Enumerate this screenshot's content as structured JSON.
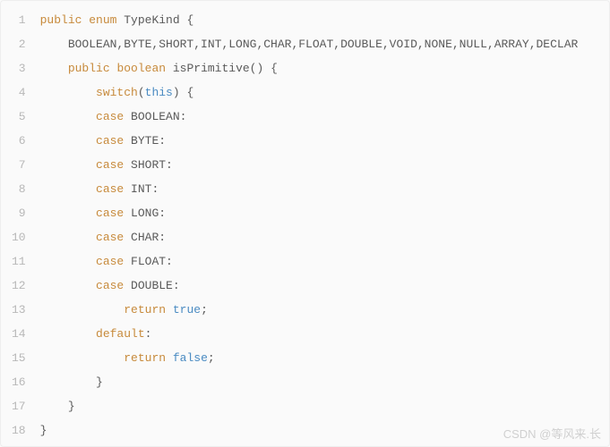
{
  "lines": [
    {
      "n": "1",
      "t": [
        {
          "c": "kw",
          "v": "public"
        },
        {
          "c": "txt",
          "v": " "
        },
        {
          "c": "kw",
          "v": "enum"
        },
        {
          "c": "txt",
          "v": " TypeKind {"
        }
      ]
    },
    {
      "n": "2",
      "t": [
        {
          "c": "txt",
          "v": "    BOOLEAN,BYTE,SHORT,INT,LONG,CHAR,FLOAT,DOUBLE,VOID,NONE,NULL,ARRAY,DECLAR"
        }
      ]
    },
    {
      "n": "3",
      "t": [
        {
          "c": "txt",
          "v": "    "
        },
        {
          "c": "kw",
          "v": "public"
        },
        {
          "c": "txt",
          "v": " "
        },
        {
          "c": "kw",
          "v": "boolean"
        },
        {
          "c": "txt",
          "v": " isPrimitive() {"
        }
      ]
    },
    {
      "n": "4",
      "t": [
        {
          "c": "txt",
          "v": "        "
        },
        {
          "c": "kw",
          "v": "switch"
        },
        {
          "c": "txt",
          "v": "("
        },
        {
          "c": "this",
          "v": "this"
        },
        {
          "c": "txt",
          "v": ") {"
        }
      ]
    },
    {
      "n": "5",
      "t": [
        {
          "c": "txt",
          "v": "        "
        },
        {
          "c": "kw",
          "v": "case"
        },
        {
          "c": "txt",
          "v": " BOOLEAN:"
        }
      ]
    },
    {
      "n": "6",
      "t": [
        {
          "c": "txt",
          "v": "        "
        },
        {
          "c": "kw",
          "v": "case"
        },
        {
          "c": "txt",
          "v": " BYTE:"
        }
      ]
    },
    {
      "n": "7",
      "t": [
        {
          "c": "txt",
          "v": "        "
        },
        {
          "c": "kw",
          "v": "case"
        },
        {
          "c": "txt",
          "v": " SHORT:"
        }
      ]
    },
    {
      "n": "8",
      "t": [
        {
          "c": "txt",
          "v": "        "
        },
        {
          "c": "kw",
          "v": "case"
        },
        {
          "c": "txt",
          "v": " INT:"
        }
      ]
    },
    {
      "n": "9",
      "t": [
        {
          "c": "txt",
          "v": "        "
        },
        {
          "c": "kw",
          "v": "case"
        },
        {
          "c": "txt",
          "v": " LONG:"
        }
      ]
    },
    {
      "n": "10",
      "t": [
        {
          "c": "txt",
          "v": "        "
        },
        {
          "c": "kw",
          "v": "case"
        },
        {
          "c": "txt",
          "v": " CHAR:"
        }
      ]
    },
    {
      "n": "11",
      "t": [
        {
          "c": "txt",
          "v": "        "
        },
        {
          "c": "kw",
          "v": "case"
        },
        {
          "c": "txt",
          "v": " FLOAT:"
        }
      ]
    },
    {
      "n": "12",
      "t": [
        {
          "c": "txt",
          "v": "        "
        },
        {
          "c": "kw",
          "v": "case"
        },
        {
          "c": "txt",
          "v": " DOUBLE:"
        }
      ]
    },
    {
      "n": "13",
      "t": [
        {
          "c": "txt",
          "v": "            "
        },
        {
          "c": "kw",
          "v": "return"
        },
        {
          "c": "txt",
          "v": " "
        },
        {
          "c": "bool",
          "v": "true"
        },
        {
          "c": "txt",
          "v": ";"
        }
      ]
    },
    {
      "n": "14",
      "t": [
        {
          "c": "txt",
          "v": "        "
        },
        {
          "c": "kw",
          "v": "default"
        },
        {
          "c": "txt",
          "v": ":"
        }
      ]
    },
    {
      "n": "15",
      "t": [
        {
          "c": "txt",
          "v": "            "
        },
        {
          "c": "kw",
          "v": "return"
        },
        {
          "c": "txt",
          "v": " "
        },
        {
          "c": "bool",
          "v": "false"
        },
        {
          "c": "txt",
          "v": ";"
        }
      ]
    },
    {
      "n": "16",
      "t": [
        {
          "c": "txt",
          "v": "        }"
        }
      ]
    },
    {
      "n": "17",
      "t": [
        {
          "c": "txt",
          "v": "    }"
        }
      ]
    },
    {
      "n": "18",
      "t": [
        {
          "c": "txt",
          "v": "}"
        }
      ]
    }
  ],
  "watermark": "CSDN @等风来.长"
}
